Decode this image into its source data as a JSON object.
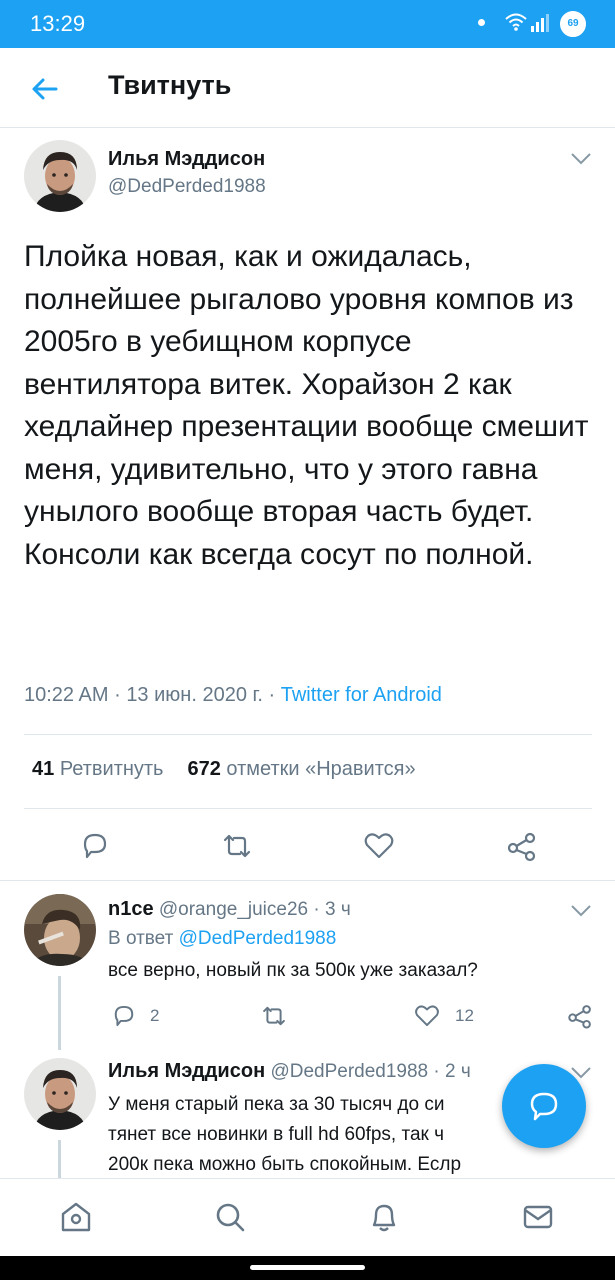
{
  "status_bar": {
    "time": "13:29",
    "battery": "69"
  },
  "header": {
    "title": "Твитнуть"
  },
  "tweet": {
    "author_name": "Илья Мэддисон",
    "author_handle": "@DedPerded1988",
    "text": "Плойка новая, как и ожидалась, полнейшее рыгалово уровня компов из 2005го в уебищном корпусе вентилятора витек. Хорайзон 2 как хедлайнер презентации вообще смешит меня, удивительно, что у этого гавна унылого вообще вторая часть будет. Консоли как всегда сосут по полной.",
    "time": "10:22 AM",
    "date": "13 июн. 2020 г.",
    "source": "Twitter for Android",
    "separator": "·",
    "retweets_count": "41",
    "retweets_label": "Ретвитнуть",
    "likes_count": "672",
    "likes_label": "отметки «Нравится»"
  },
  "replies": [
    {
      "name": "n1ce",
      "handle": "@orange_juice26",
      "age": "3 ч",
      "reply_to_label": "В ответ",
      "reply_to_handle": "@DedPerded1988",
      "text": "все верно, новый пк за 500к уже заказал?",
      "reply_count": "2",
      "like_count": "12"
    },
    {
      "name": "Илья Мэддисон",
      "handle": "@DedPerded1988",
      "age": "2 ч",
      "text_lines": [
        "У меня старый пека за 30 тысяч до си",
        "тянет все новинки в full hd 60fps, так ч",
        "200к пека можно быть спокойным. Еслр"
      ]
    }
  ],
  "colors": {
    "accent": "#1da1f2",
    "text": "#14171a",
    "secondary": "#657786",
    "divider": "#e1e8ed"
  },
  "icons": [
    "back-arrow-icon",
    "chevron-down-icon",
    "reply-icon",
    "retweet-icon",
    "like-icon",
    "share-icon",
    "compose-icon",
    "home-icon",
    "search-icon",
    "notifications-icon",
    "messages-icon"
  ]
}
